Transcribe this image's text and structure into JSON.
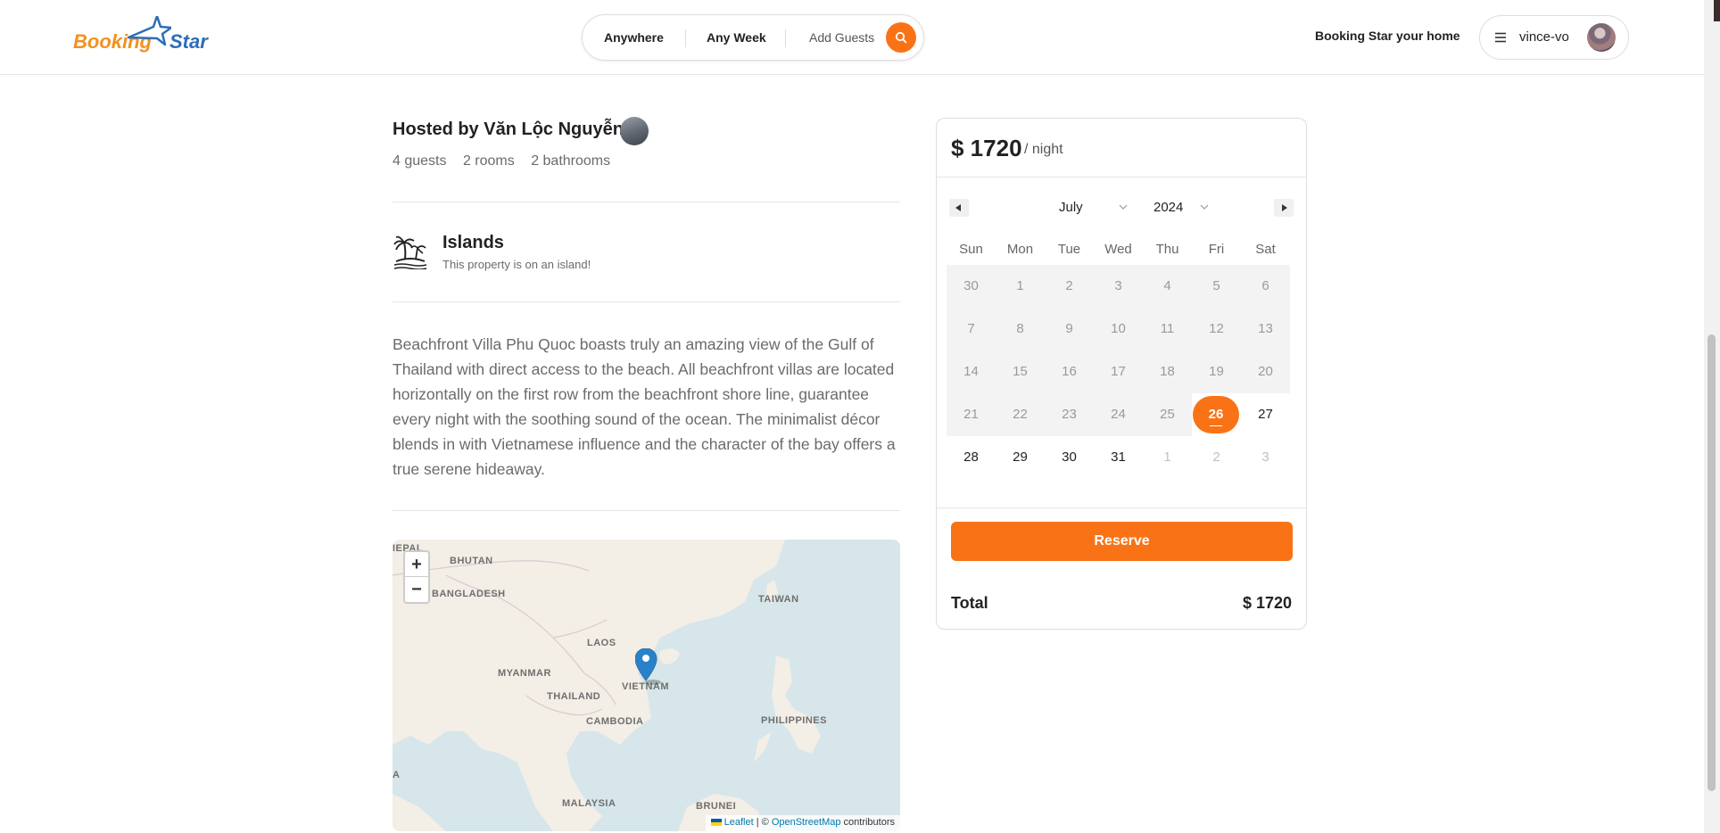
{
  "header": {
    "logo_part1": "Booking",
    "logo_part2": "Star",
    "search": {
      "where": "Anywhere",
      "when": "Any Week",
      "guests": "Add Guests"
    },
    "host_link": "Booking Star your home",
    "username": "vince-vo"
  },
  "listing": {
    "host": "Hosted by Văn Lộc Nguyễn",
    "stats": [
      "4 guests",
      "2 rooms",
      "2 bathrooms"
    ],
    "category": {
      "title": "Islands",
      "description": "This property is on an island!"
    },
    "description": "Beachfront Villa Phu Quoc boasts truly an amazing view of the Gulf of Thailand with direct access to the beach. All beachfront villas are located horizontally on the first row from the beachfront shore line, guarantee every night with the soothing sound of the ocean. The minimalist décor blends in with Vietnamese influence and the character of the bay offers a true serene hideaway."
  },
  "map": {
    "zoom_in": "+",
    "zoom_out": "−",
    "labels": [
      "BHUTAN",
      "BANGLADESH",
      "TAIWAN",
      "LAOS",
      "MYANMAR",
      "VIETNAM",
      "THAILAND",
      "CAMBODIA",
      "PHILIPPINES",
      "MALAYSIA",
      "BRUNEI",
      "IEPAL",
      "A"
    ],
    "attribution_leaflet": "Leaflet",
    "attribution_sep": " | © ",
    "attribution_osm": "OpenStreetMap",
    "attribution_tail": " contributors"
  },
  "booking": {
    "price": "$ 1720",
    "per": "/ night",
    "calendar": {
      "month": "July",
      "year": "2024",
      "weekdays": [
        "Sun",
        "Mon",
        "Tue",
        "Wed",
        "Thu",
        "Fri",
        "Sat"
      ],
      "weeks": [
        [
          "30",
          "1",
          "2",
          "3",
          "4",
          "5",
          "6"
        ],
        [
          "7",
          "8",
          "9",
          "10",
          "11",
          "12",
          "13"
        ],
        [
          "14",
          "15",
          "16",
          "17",
          "18",
          "19",
          "20"
        ],
        [
          "21",
          "22",
          "23",
          "24",
          "25",
          "26",
          "27"
        ],
        [
          "28",
          "29",
          "30",
          "31",
          "1",
          "2",
          "3"
        ]
      ],
      "selected_day": "26"
    },
    "reserve_label": "Reserve",
    "total_label": "Total",
    "total_value": "$ 1720"
  },
  "colors": {
    "accent": "#f97316",
    "logo_orange": "#f5901e",
    "logo_blue": "#2d6db5",
    "map_water": "#d6e6ea",
    "map_land": "#f3eee6"
  },
  "icons": {
    "search": "search-icon",
    "menu": "hamburger-icon",
    "category": "palm-island-icon",
    "map_pin": "map-pin-icon"
  }
}
